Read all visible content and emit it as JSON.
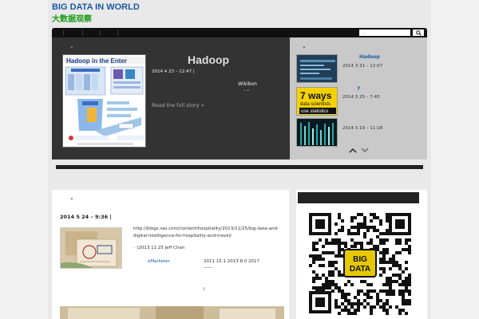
{
  "header": {
    "site_title": "BIG DATA IN WORLD",
    "site_subtitle": "大数据观察"
  },
  "search": {
    "placeholder": "..."
  },
  "featured": {
    "crumb": "»",
    "title": "Hadoop",
    "image_text": "Hadoop in the Enter",
    "meta": "2014  4  23   –     12:47 |",
    "source": "Wikibon",
    "source_dots": "–   •",
    "read_more": "Read the full story »"
  },
  "slider": {
    "crumb": "»",
    "items": [
      {
        "title": "Hadoop",
        "date": "2014  3  31   –     12:07"
      },
      {
        "title": "7",
        "date": "2014  3  25   –     7:45"
      },
      {
        "title": "",
        "date": "2014  3  19   –     11:18"
      }
    ],
    "thumb2_text": {
      "line1": "7 ways",
      "line2": "data scientists",
      "line3": "use statistics"
    }
  },
  "post": {
    "crumb": "»",
    "meta": "2014  5  24   –     9:36 |",
    "url": "http://blogs.sas.com/content/hospitality/2013/11/25/big-data-and-digital-intelligence-for-hospitality-and-travel/",
    "author": "·    |2013  11  25       Jeff Chan",
    "emarketer": "eMarketer",
    "stats": "2011  15.1    2013  8.0     2017",
    "dash": "——",
    "paren": ")"
  },
  "qr": {
    "label_line1": "BIG",
    "label_line2": "DATA"
  },
  "colors": {
    "title_blue": "#1a5aa8",
    "subtitle_green": "#1a9a1a",
    "featured_bg": "#333333",
    "slider_bg": "#c9c9c9",
    "qr_badge": "#e6c800"
  }
}
